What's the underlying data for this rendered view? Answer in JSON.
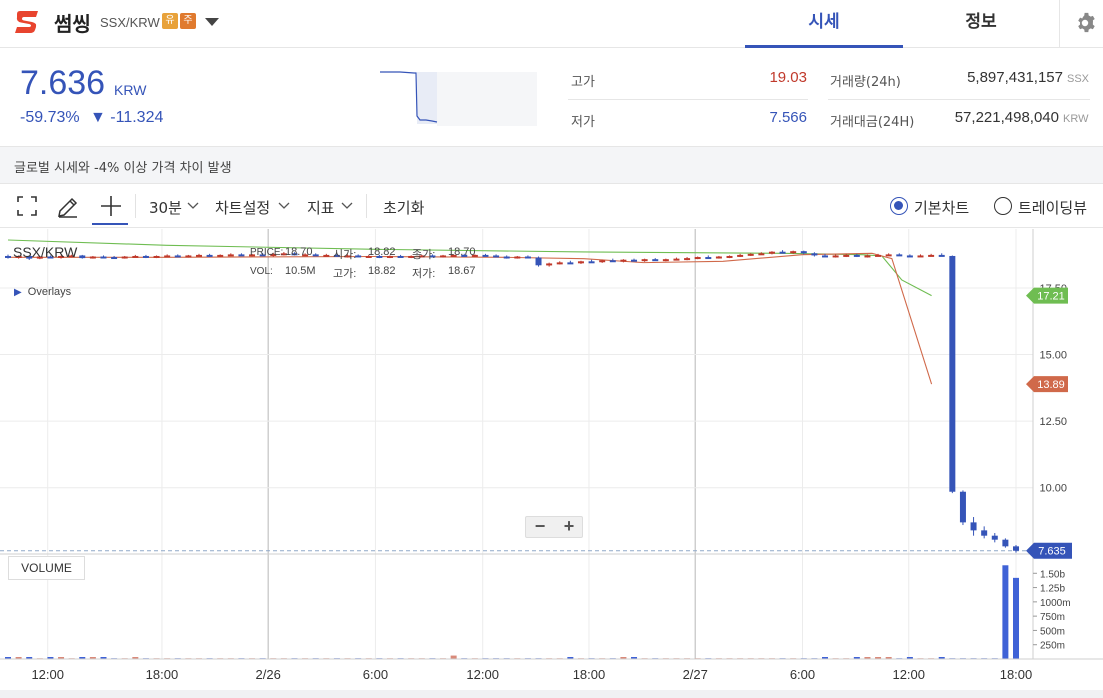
{
  "header": {
    "coin_name": "썸씽",
    "pair": "SSX/KRW",
    "badge_warning": "유",
    "badge_caution": "주",
    "tabs": [
      {
        "label": "시세",
        "active": true
      },
      {
        "label": "정보",
        "active": false
      }
    ],
    "icons": {
      "logo": "sometimes-logo",
      "dropdown": "caret-down-icon",
      "settings": "gear-icon"
    },
    "colors": {
      "accent": "#3554b8",
      "logo": "#e8442e",
      "badge_warning": "#e8a23a",
      "badge_caution": "#e07a2e"
    }
  },
  "summary": {
    "price": "7.636",
    "unit": "KRW",
    "change_rate": "-59.73%",
    "change_amount": "▼ -11.324",
    "stats": {
      "high_label": "고가",
      "high_value": "19.03",
      "low_label": "저가",
      "low_value": "7.566",
      "volume_label": "거래량(24h)",
      "volume_value": "5,897,431,157",
      "volume_unit": "SSX",
      "amount_label": "거래대금(24H)",
      "amount_value": "57,221,498,040",
      "amount_unit": "KRW"
    },
    "colors": {
      "rise": "#c0392b",
      "fall": "#3554b8"
    }
  },
  "notice": {
    "text": "글로벌 시세와 -4% 이상 가격 차이 발생"
  },
  "toolbar": {
    "interval_label": "30분",
    "chart_settings_label": "차트설정",
    "indicators_label": "지표",
    "reset_label": "초기화",
    "basic_chart_label": "기본차트",
    "tradingview_label": "트레이딩뷰",
    "selected_chart": "basic",
    "icons": [
      "fullscreen-icon",
      "pencil-icon",
      "crosshair-icon",
      "caret-down-icon"
    ]
  },
  "chart": {
    "pair_label": "SSX/KRW",
    "overlays_label": "Overlays",
    "info": {
      "price_label": "PRICE:",
      "price_value": "18.70",
      "open_label": "시가:",
      "open_value": "18.82",
      "close_label": "종가:",
      "close_value": "18.70",
      "vol_label": "VOL:",
      "vol_value": "10.5M",
      "high_label": "고가:",
      "high_value": "18.82",
      "low_label": "저가:",
      "low_value": "18.67"
    },
    "zoom_out_label": "−",
    "zoom_in_label": "+",
    "volume_button_label": "VOLUME",
    "colors": {
      "up": "#c0392b",
      "down": "#3554b8",
      "ma_short": "#d0694a",
      "ma_long": "#6fbd52"
    }
  },
  "chart_data": {
    "type": "candlestick",
    "x_ticks": [
      "12:00",
      "18:00",
      "2/26",
      "6:00",
      "12:00",
      "18:00",
      "2/27",
      "6:00",
      "12:00",
      "18:00"
    ],
    "y_ticks": [
      "17.50",
      "15.00",
      "12.50",
      "10.00"
    ],
    "ylim": [
      7.4,
      19.6
    ],
    "volume_ticks": [
      "1.50b",
      "1.25b",
      "1000m",
      "750m",
      "500m",
      "250m"
    ],
    "volume_max": 1.75,
    "last_price": 7.635,
    "last_price_label": "7.635",
    "overlays": [
      {
        "name": "ma_long",
        "value": 17.21,
        "label": "17.21",
        "color": "#6fbd52",
        "points": [
          [
            0,
            19.3
          ],
          [
            16,
            19.1
          ],
          [
            37,
            18.95
          ],
          [
            58,
            18.85
          ],
          [
            78,
            18.8
          ],
          [
            86,
            18.75
          ],
          [
            88,
            18.7
          ],
          [
            90,
            17.8
          ],
          [
            93,
            17.21
          ]
        ]
      },
      {
        "name": "ma_short",
        "value": 13.89,
        "label": "13.89",
        "color": "#d0694a",
        "points": [
          [
            0,
            18.65
          ],
          [
            16,
            18.65
          ],
          [
            37,
            18.68
          ],
          [
            50,
            18.65
          ],
          [
            58,
            18.6
          ],
          [
            64,
            18.45
          ],
          [
            72,
            18.5
          ],
          [
            80,
            18.75
          ],
          [
            87,
            18.8
          ],
          [
            89,
            18.6
          ],
          [
            93,
            13.89
          ]
        ]
      }
    ],
    "candles": {
      "x_start": 0,
      "x_step": 1,
      "ohlc": [
        [
          18.7,
          18.75,
          18.6,
          18.65
        ],
        [
          18.65,
          18.72,
          18.6,
          18.7
        ],
        [
          18.7,
          18.72,
          18.55,
          18.6
        ],
        [
          18.6,
          18.7,
          18.58,
          18.68
        ],
        [
          18.68,
          18.72,
          18.62,
          18.64
        ],
        [
          18.64,
          18.72,
          18.6,
          18.7
        ],
        [
          18.7,
          18.75,
          18.65,
          18.72
        ],
        [
          18.72,
          18.74,
          18.6,
          18.62
        ],
        [
          18.62,
          18.7,
          18.6,
          18.68
        ],
        [
          18.68,
          18.72,
          18.62,
          18.66
        ],
        [
          18.66,
          18.7,
          18.6,
          18.64
        ],
        [
          18.64,
          18.7,
          18.6,
          18.68
        ],
        [
          18.68,
          18.74,
          18.64,
          18.7
        ],
        [
          18.7,
          18.74,
          18.62,
          18.66
        ],
        [
          18.66,
          18.72,
          18.62,
          18.7
        ],
        [
          18.7,
          18.76,
          18.66,
          18.72
        ],
        [
          18.72,
          18.76,
          18.66,
          18.68
        ],
        [
          18.68,
          18.74,
          18.64,
          18.72
        ],
        [
          18.72,
          18.78,
          18.68,
          18.74
        ],
        [
          18.74,
          18.78,
          18.66,
          18.7
        ],
        [
          18.7,
          18.76,
          18.66,
          18.74
        ],
        [
          18.74,
          18.8,
          18.7,
          18.76
        ],
        [
          18.76,
          18.8,
          18.7,
          18.72
        ],
        [
          18.72,
          18.78,
          18.68,
          18.76
        ],
        [
          18.76,
          18.82,
          18.7,
          18.7
        ],
        [
          18.7,
          18.82,
          18.67,
          18.78
        ],
        [
          18.78,
          18.85,
          18.72,
          18.8
        ],
        [
          18.8,
          18.84,
          18.72,
          18.74
        ],
        [
          18.74,
          18.8,
          18.7,
          18.76
        ],
        [
          18.76,
          18.8,
          18.7,
          18.72
        ],
        [
          18.72,
          18.78,
          18.68,
          18.74
        ],
        [
          18.74,
          18.78,
          18.68,
          18.7
        ],
        [
          18.7,
          18.76,
          18.64,
          18.72
        ],
        [
          18.72,
          18.76,
          18.66,
          18.68
        ],
        [
          18.68,
          18.74,
          18.64,
          18.7
        ],
        [
          18.7,
          18.74,
          18.62,
          18.66
        ],
        [
          18.66,
          18.72,
          18.62,
          18.7
        ],
        [
          18.7,
          18.74,
          18.64,
          18.68
        ],
        [
          18.68,
          18.72,
          18.62,
          18.7
        ],
        [
          18.7,
          18.74,
          18.66,
          18.72
        ],
        [
          18.72,
          18.76,
          18.66,
          18.68
        ],
        [
          18.68,
          18.74,
          18.64,
          18.72
        ],
        [
          18.72,
          18.76,
          18.68,
          18.74
        ],
        [
          18.74,
          18.78,
          18.68,
          18.7
        ],
        [
          18.7,
          18.76,
          18.66,
          18.74
        ],
        [
          18.74,
          18.78,
          18.7,
          18.72
        ],
        [
          18.72,
          18.76,
          18.66,
          18.68
        ],
        [
          18.68,
          18.72,
          18.6,
          18.66
        ],
        [
          18.66,
          18.7,
          18.6,
          18.68
        ],
        [
          18.68,
          18.72,
          18.62,
          18.64
        ],
        [
          18.64,
          18.68,
          18.3,
          18.35
        ],
        [
          18.35,
          18.45,
          18.3,
          18.42
        ],
        [
          18.42,
          18.5,
          18.38,
          18.46
        ],
        [
          18.46,
          18.52,
          18.4,
          18.44
        ],
        [
          18.44,
          18.52,
          18.4,
          18.5
        ],
        [
          18.5,
          18.56,
          18.44,
          18.48
        ],
        [
          18.48,
          18.56,
          18.44,
          18.54
        ],
        [
          18.54,
          18.6,
          18.48,
          18.52
        ],
        [
          18.52,
          18.58,
          18.46,
          18.56
        ],
        [
          18.56,
          18.6,
          18.5,
          18.52
        ],
        [
          18.52,
          18.6,
          18.48,
          18.58
        ],
        [
          18.58,
          18.62,
          18.52,
          18.54
        ],
        [
          18.54,
          18.6,
          18.5,
          18.58
        ],
        [
          18.58,
          18.64,
          18.54,
          18.6
        ],
        [
          18.6,
          18.66,
          18.54,
          18.62
        ],
        [
          18.62,
          18.68,
          18.58,
          18.66
        ],
        [
          18.66,
          18.72,
          18.6,
          18.64
        ],
        [
          18.64,
          18.7,
          18.6,
          18.68
        ],
        [
          18.68,
          18.72,
          18.62,
          18.7
        ],
        [
          18.7,
          18.78,
          18.66,
          18.74
        ],
        [
          18.74,
          18.8,
          18.7,
          18.78
        ],
        [
          18.78,
          18.84,
          18.74,
          18.8
        ],
        [
          18.8,
          18.88,
          18.76,
          18.86
        ],
        [
          18.86,
          18.92,
          18.8,
          18.84
        ],
        [
          18.84,
          18.9,
          18.78,
          18.88
        ],
        [
          18.88,
          18.9,
          18.76,
          18.8
        ],
        [
          18.8,
          18.84,
          18.68,
          18.72
        ],
        [
          18.72,
          18.78,
          18.66,
          18.7
        ],
        [
          18.7,
          18.76,
          18.64,
          18.72
        ],
        [
          18.72,
          18.78,
          18.66,
          18.74
        ],
        [
          18.74,
          18.78,
          18.66,
          18.7
        ],
        [
          18.7,
          18.76,
          18.64,
          18.72
        ],
        [
          18.72,
          18.78,
          18.68,
          18.74
        ],
        [
          18.74,
          18.8,
          18.7,
          18.76
        ],
        [
          18.76,
          18.8,
          18.7,
          18.72
        ],
        [
          18.72,
          18.76,
          18.66,
          18.7
        ],
        [
          18.7,
          18.76,
          18.66,
          18.72
        ],
        [
          18.72,
          18.78,
          18.68,
          18.74
        ],
        [
          18.74,
          18.8,
          18.68,
          18.7
        ],
        [
          18.7,
          18.72,
          9.8,
          9.85
        ],
        [
          9.85,
          9.9,
          8.6,
          8.7
        ],
        [
          8.7,
          8.9,
          8.2,
          8.4
        ],
        [
          8.4,
          8.55,
          8.1,
          8.2
        ],
        [
          8.2,
          8.3,
          7.95,
          8.05
        ],
        [
          8.05,
          8.1,
          7.75,
          7.8
        ],
        [
          7.8,
          7.85,
          7.566,
          7.635
        ]
      ],
      "volumes": [
        0.01,
        0.01,
        0.01,
        0.0,
        0.01,
        0.01,
        0.0,
        0.01,
        0.02,
        0.01,
        0.0,
        0.0,
        0.01,
        0.0,
        0.0,
        0.0,
        0.0,
        0.0,
        0.0,
        0.0,
        0.0,
        0.0,
        0.0,
        0.0,
        0.0,
        0.0,
        0.0,
        0.0,
        0.0,
        0.0,
        0.0,
        0.0,
        0.0,
        0.0,
        0.0,
        0.0,
        0.0,
        0.0,
        0.0,
        0.0,
        0.0,
        0.0,
        0.06,
        0.0,
        0.0,
        0.0,
        0.0,
        0.0,
        0.0,
        0.0,
        0.0,
        0.0,
        0.0,
        0.01,
        0.0,
        0.0,
        0.0,
        0.0,
        0.01,
        0.02,
        0.0,
        0.0,
        0.0,
        0.0,
        0.0,
        0.0,
        0.0,
        0.0,
        0.0,
        0.0,
        0.0,
        0.0,
        0.0,
        0.0,
        0.0,
        0.0,
        0.0,
        0.01,
        0.0,
        0.0,
        0.01,
        0.01,
        0.02,
        0.01,
        0.0,
        0.01,
        0.0,
        0.0,
        0.01,
        0.0,
        0.0,
        0.0,
        0.0,
        0.0,
        1.64,
        1.42,
        1.22,
        0.98,
        0.55,
        0.44,
        0.32,
        0.35
      ]
    }
  }
}
